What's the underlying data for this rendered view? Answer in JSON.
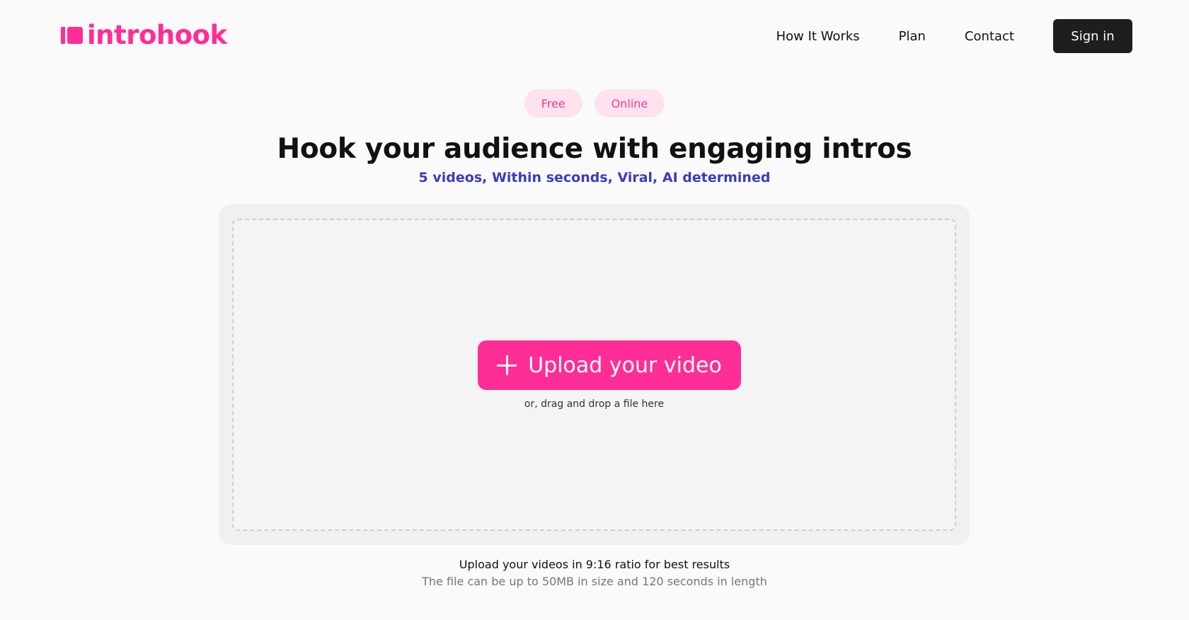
{
  "brand": {
    "name": "introhook",
    "accent": "#ff2d96"
  },
  "nav": {
    "items": [
      {
        "label": "How It Works"
      },
      {
        "label": "Plan"
      },
      {
        "label": "Contact"
      }
    ],
    "signin_label": "Sign in"
  },
  "pills": [
    {
      "label": "Free"
    },
    {
      "label": "Online"
    }
  ],
  "hero": {
    "title": "Hook your audience with engaging intros",
    "subtitle": "5 videos, Within seconds, Viral, AI determined"
  },
  "upload": {
    "button_label": "Upload your video",
    "button_icon": "plus-icon",
    "hint": "or, drag and drop a file here"
  },
  "notes": {
    "ratio": "Upload your videos in 9:16 ratio for best results",
    "limits": "The file can be up to 50MB in size and 120 seconds in length"
  },
  "colors": {
    "accent": "#ff2d96",
    "pill_bg": "#ffe1ef",
    "pill_text": "#e83e8c",
    "subtitle": "#3b3bbf",
    "signin_bg": "#1e1e1e"
  }
}
